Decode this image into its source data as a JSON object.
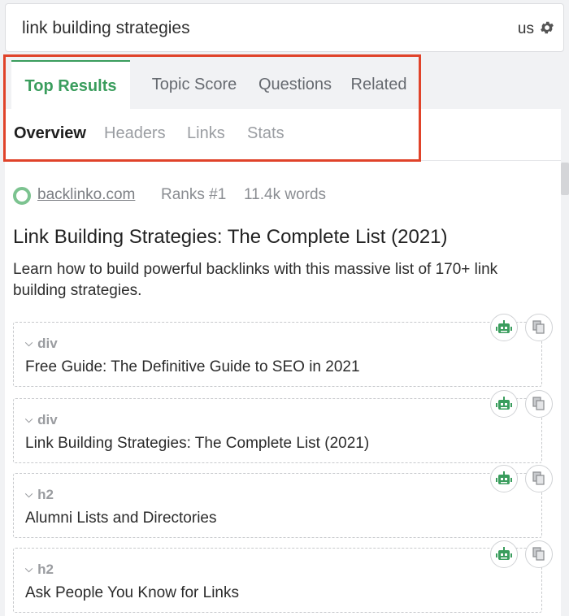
{
  "search": {
    "query": "link building strategies",
    "country": "us"
  },
  "tabs": [
    {
      "label": "Top Results"
    },
    {
      "label": "Topic Score"
    },
    {
      "label": "Questions"
    },
    {
      "label": "Related"
    }
  ],
  "subtabs": [
    {
      "label": "Overview"
    },
    {
      "label": "Headers"
    },
    {
      "label": "Links"
    },
    {
      "label": "Stats"
    }
  ],
  "result": {
    "site": "backlinko.com",
    "rank": "Ranks #1",
    "words": "11.4k words",
    "title": "Link Building Strategies: The Complete List (2021)",
    "description": "Learn how to build powerful backlinks with this massive list of 170+ link building strategies."
  },
  "cards": [
    {
      "tag": "div",
      "text": "Free Guide: The Definitive Guide to SEO in 2021"
    },
    {
      "tag": "div",
      "text": "Link Building Strategies: The Complete List (2021)"
    },
    {
      "tag": "h2",
      "text": "Alumni Lists and Directories"
    },
    {
      "tag": "h2",
      "text": "Ask People You Know for Links"
    }
  ],
  "colors": {
    "accent": "#3a9d5d",
    "highlight": "#e0432a",
    "robot": "#3a9d5d"
  },
  "icons": {
    "settings": "gear-icon",
    "assistant": "robot-icon",
    "copy": "copy-icon",
    "site": "ring-icon"
  }
}
